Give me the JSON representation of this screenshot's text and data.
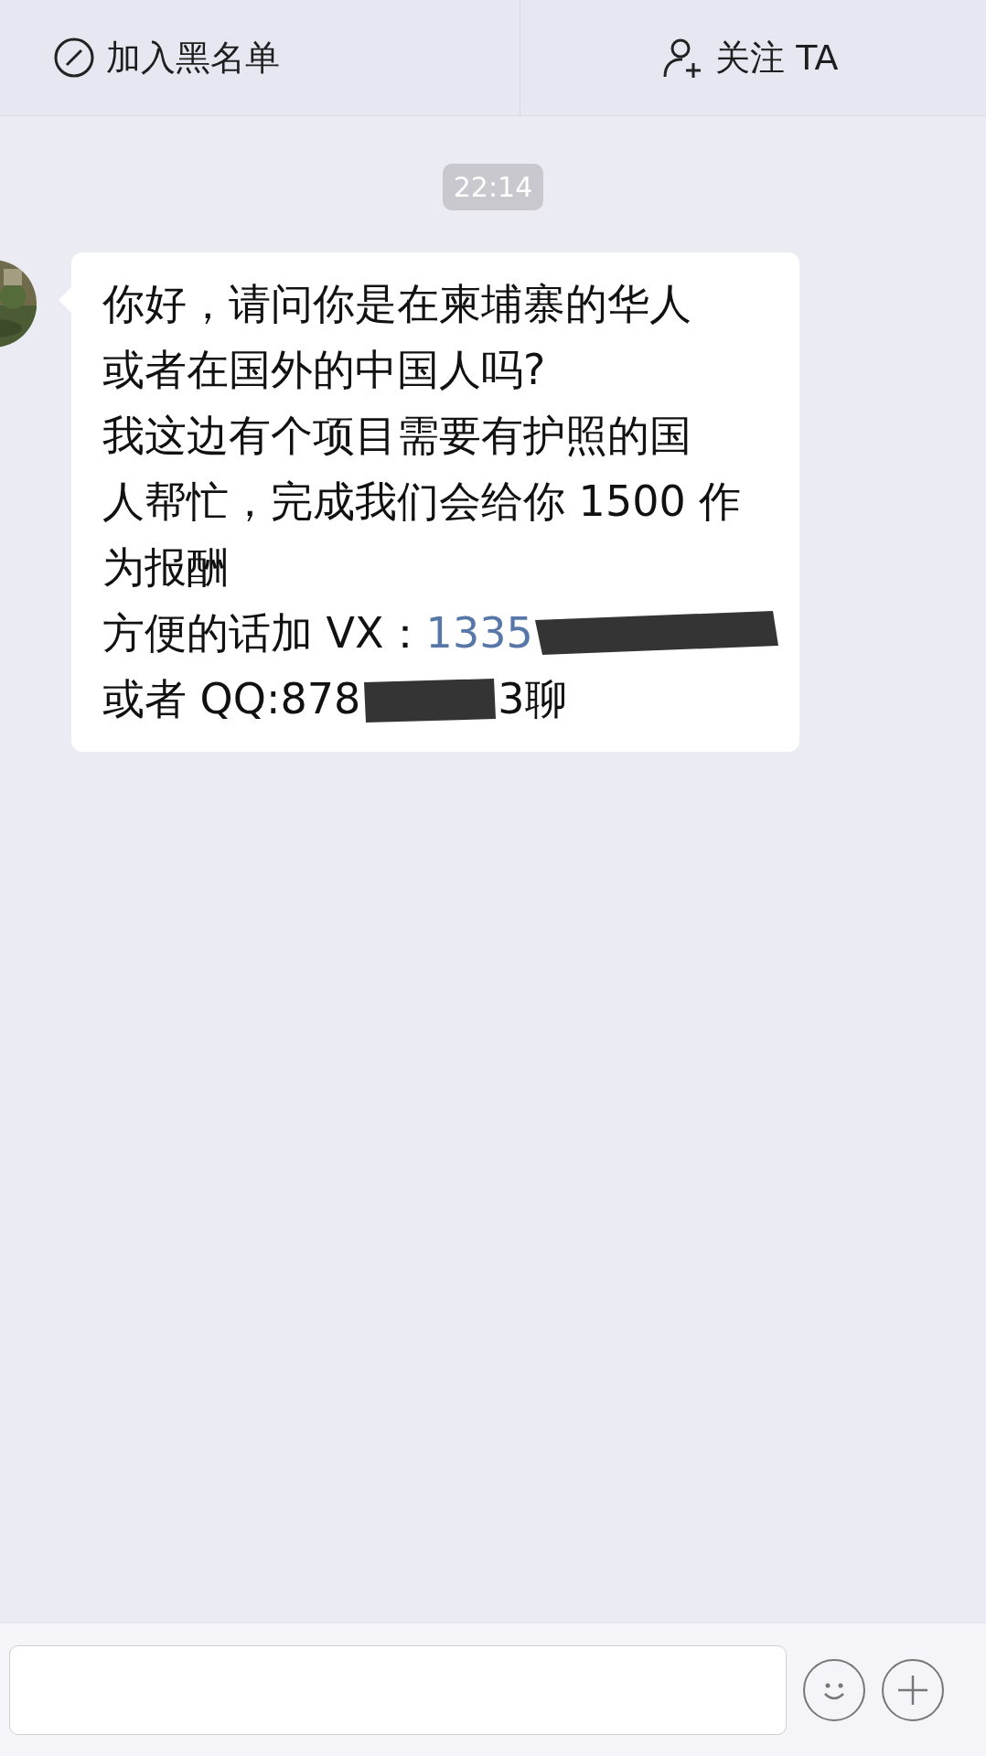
{
  "top_bar": {
    "actions": [
      {
        "kind": "block",
        "label": "加入黑名单"
      },
      {
        "kind": "follow",
        "label": "关注 TA"
      }
    ]
  },
  "chat": {
    "timestamp": "22:14",
    "messages": [
      {
        "avatar": {
          "kind": "picture"
        },
        "lines": [
          [
            {
              "kind": "text",
              "text": "你好，请问你是在柬埔寨的华人"
            }
          ],
          [
            {
              "kind": "text",
              "text": "或者在国外的中国人吗?"
            }
          ],
          [
            {
              "kind": "text",
              "text": "我这边有个项目需要有护照的国"
            }
          ],
          [
            {
              "kind": "text",
              "text": "人帮忙，完成我们会给你 1500 作"
            }
          ],
          [
            {
              "kind": "text",
              "text": "为报酬"
            }
          ],
          [
            {
              "kind": "text",
              "text": "方便的话加 VX："
            },
            {
              "kind": "link",
              "text": "1335"
            },
            {
              "kind": "redacted"
            }
          ],
          [
            {
              "kind": "text",
              "text": "或者 QQ:878"
            },
            {
              "kind": "redacted"
            },
            {
              "kind": "text",
              "text": "3聊"
            }
          ]
        ]
      }
    ]
  },
  "input_bar": {
    "buttons": [
      {
        "kind": "emoji"
      },
      {
        "kind": "plus"
      }
    ]
  }
}
